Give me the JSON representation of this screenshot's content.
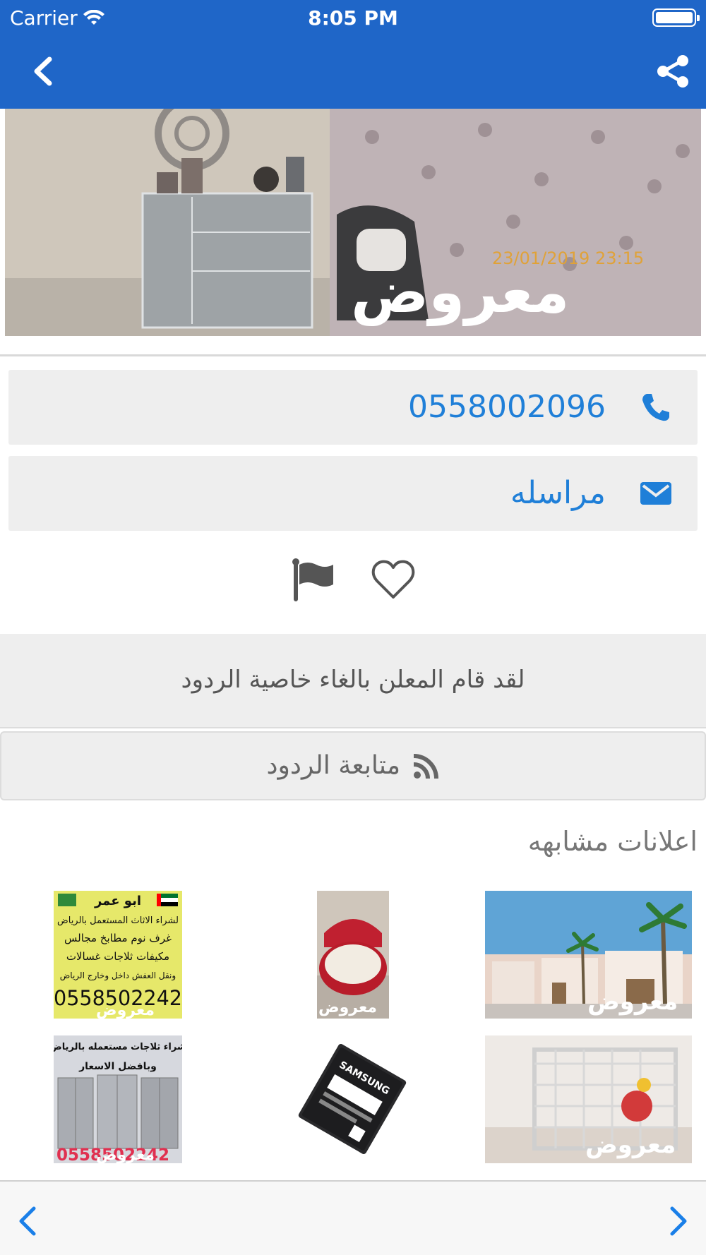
{
  "status_bar": {
    "carrier": "Carrier",
    "time": "8:05 PM"
  },
  "nav": {
    "back_icon": "chevron-left-icon",
    "share_icon": "share-icon"
  },
  "hero": {
    "timestamp": "23/01/2019 23:15",
    "watermark": "معروض"
  },
  "contact": {
    "phone": "0558002096",
    "message_label": "مراسله"
  },
  "notice": {
    "text": "لقد قام المعلن بالغاء خاصية الردود"
  },
  "follow": {
    "label": "متابعة الردود"
  },
  "similar": {
    "title": "اعلانات مشابهه",
    "items": [
      {
        "watermark": "معروض"
      },
      {
        "watermark": "معروض"
      },
      {
        "watermark": "معروض",
        "name": "ابو عمر",
        "lines": [
          "لشراء الاثاث المستعمل بالرياض",
          "غرف نوم مطابخ مجالس",
          "مكيفات ثلاجات غسالات",
          "ونقل العفش داخل وخارج الرياض"
        ],
        "phone": "0558502242"
      },
      {
        "watermark": "معروض"
      },
      {
        "brand": "SAMSUNG"
      },
      {
        "watermark": "معروض",
        "line1": "شراء ثلاجات مستعمله بالرياض",
        "line2": "وبافضل الاسعار",
        "phone": "0558502242"
      }
    ]
  },
  "colors": {
    "primary": "#1f66c8",
    "link": "#1f7fd8",
    "panel": "#eeeeee"
  }
}
